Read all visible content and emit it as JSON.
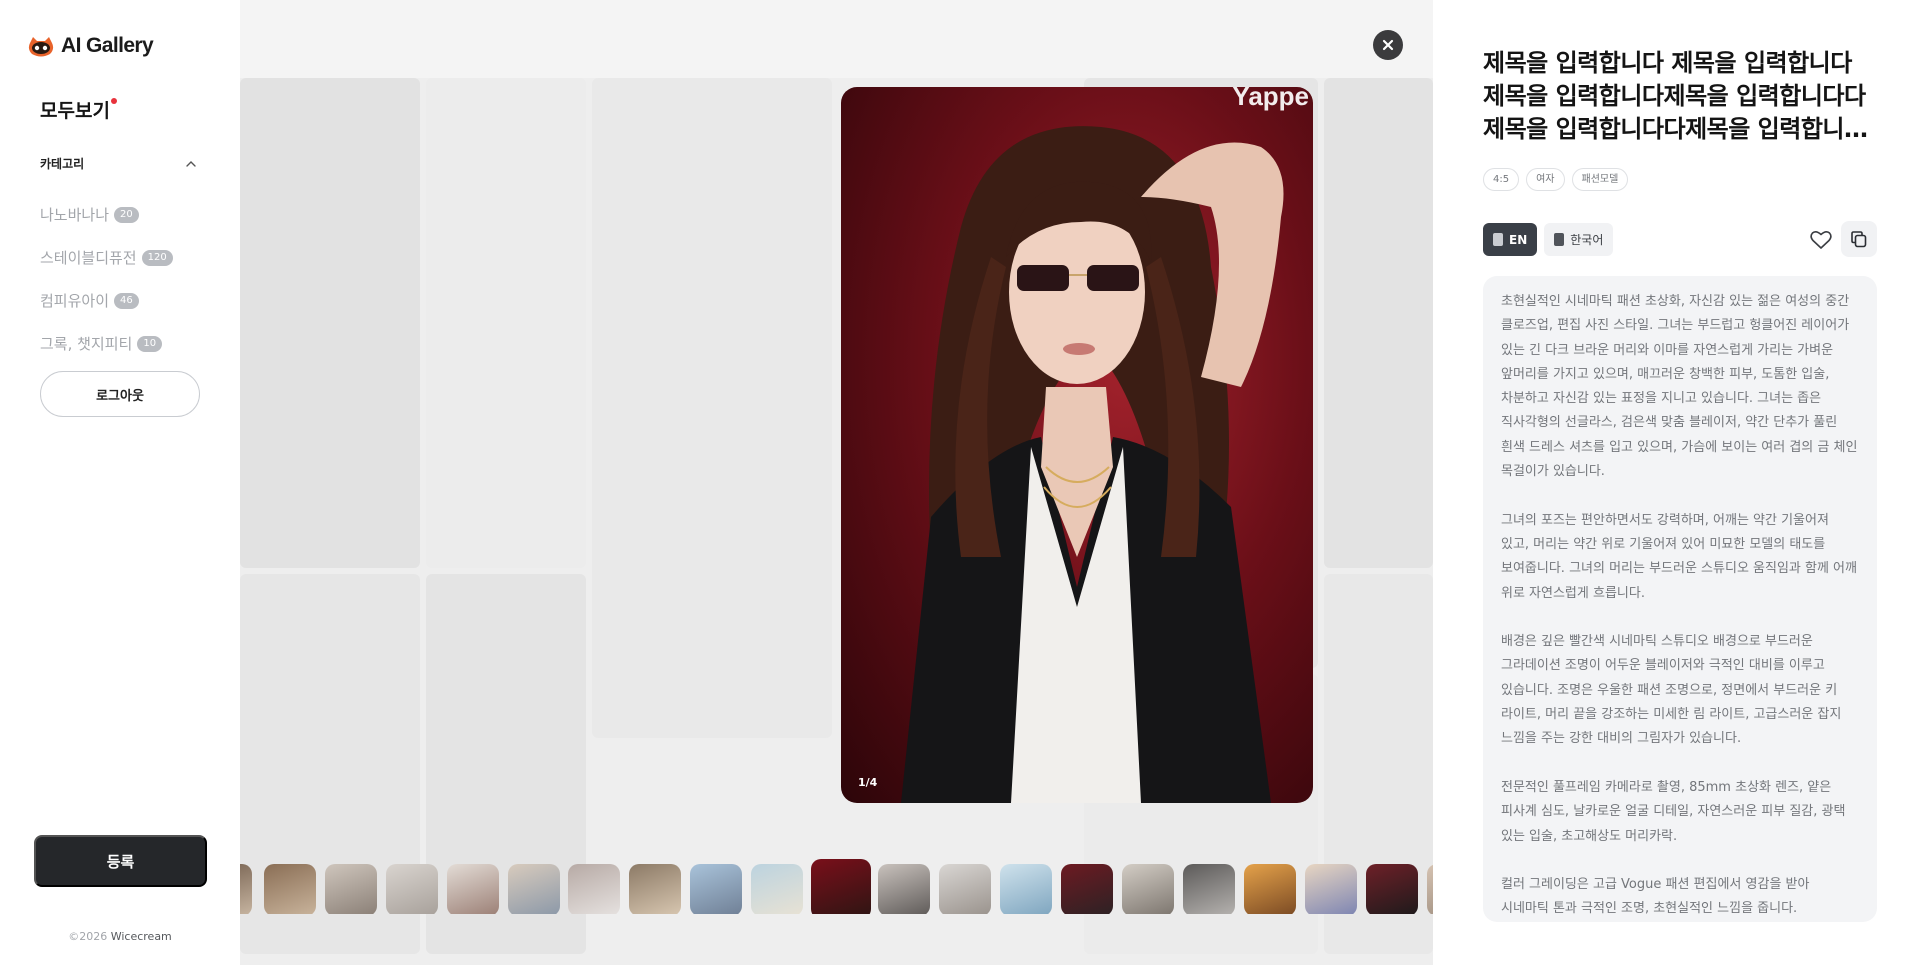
{
  "sidebar": {
    "logo_text": "AI Gallery",
    "all_view_label": "모두보기",
    "category_header": "카테고리",
    "categories": [
      {
        "label": "나노바나나",
        "count": "20"
      },
      {
        "label": "스테이블디퓨전",
        "count": "120"
      },
      {
        "label": "컴피유아이",
        "count": "46"
      },
      {
        "label": "그록, 챗지피티",
        "count": "10"
      }
    ],
    "logout_label": "로그아웃",
    "register_label": "등록",
    "copyright_prefix": "©2026",
    "copyright_brand": "Wicecream"
  },
  "viewer": {
    "watermark": "Yappe",
    "counter": "1/4",
    "close_icon": "close-icon",
    "accent_bg": "#8e1b25"
  },
  "detail": {
    "title": "제목을 입력합니다 제목을 입력합니다제목을 입력합니다제목을 입력합니다다제목을 입력합니다다제목을 입력합니다다제목을 입력합니다",
    "tags": [
      "4:5",
      "여자",
      "패션모델"
    ],
    "lang_en": "EN",
    "lang_ko": "한국어",
    "description": [
      "초현실적인 시네마틱 패션 초상화, 자신감 있는 젊은 여성의 중간 클로즈업, 편집 사진 스타일. 그녀는 부드럽고 헝클어진 레이어가 있는 긴 다크 브라운 머리와 이마를 자연스럽게 가리는 가벼운 앞머리를 가지고 있으며, 매끄러운 창백한 피부, 도톰한 입술, 차분하고 자신감 있는 표정을 지니고 있습니다. 그녀는 좁은 직사각형의 선글라스, 검은색 맞춤 블레이저, 약간 단추가 풀린 흰색 드레스 셔츠를 입고 있으며, 가슴에 보이는 여러 겹의 금 체인 목걸이가 있습니다.",
      "그녀의 포즈는 편안하면서도 강력하며, 어깨는 약간 기울어져 있고, 머리는 약간 위로 기울어져 있어 미묘한 모델의 태도를 보여줍니다. 그녀의 머리는 부드러운 스튜디오 움직임과 함께 어깨 위로 자연스럽게 흐릅니다.",
      "배경은 깊은 빨간색 시네마틱 스튜디오 배경으로 부드러운 그라데이션 조명이 어두운 블레이저와 극적인 대비를 이루고 있습니다. 조명은 우울한 패션 조명으로, 정면에서 부드러운 키 라이트, 머리 끝을 강조하는 미세한 림 라이트, 고급스러운 잡지 느낌을 주는 강한 대비의 그림자가 있습니다.",
      "전문적인 풀프레임 카메라로 촬영, 85mm 초상화 렌즈, 얕은 피사계 심도, 날카로운 얼굴 디테일, 자연스러운 피부 질감, 광택 있는 입술, 초고해상도 머리카락.",
      "컬러 그레이딩은 고급 Vogue 패션 편집에서 영감을 받아 시네마틱 톤과 극적인 조명, 초현실적인 느낌을 줍니다."
    ]
  }
}
